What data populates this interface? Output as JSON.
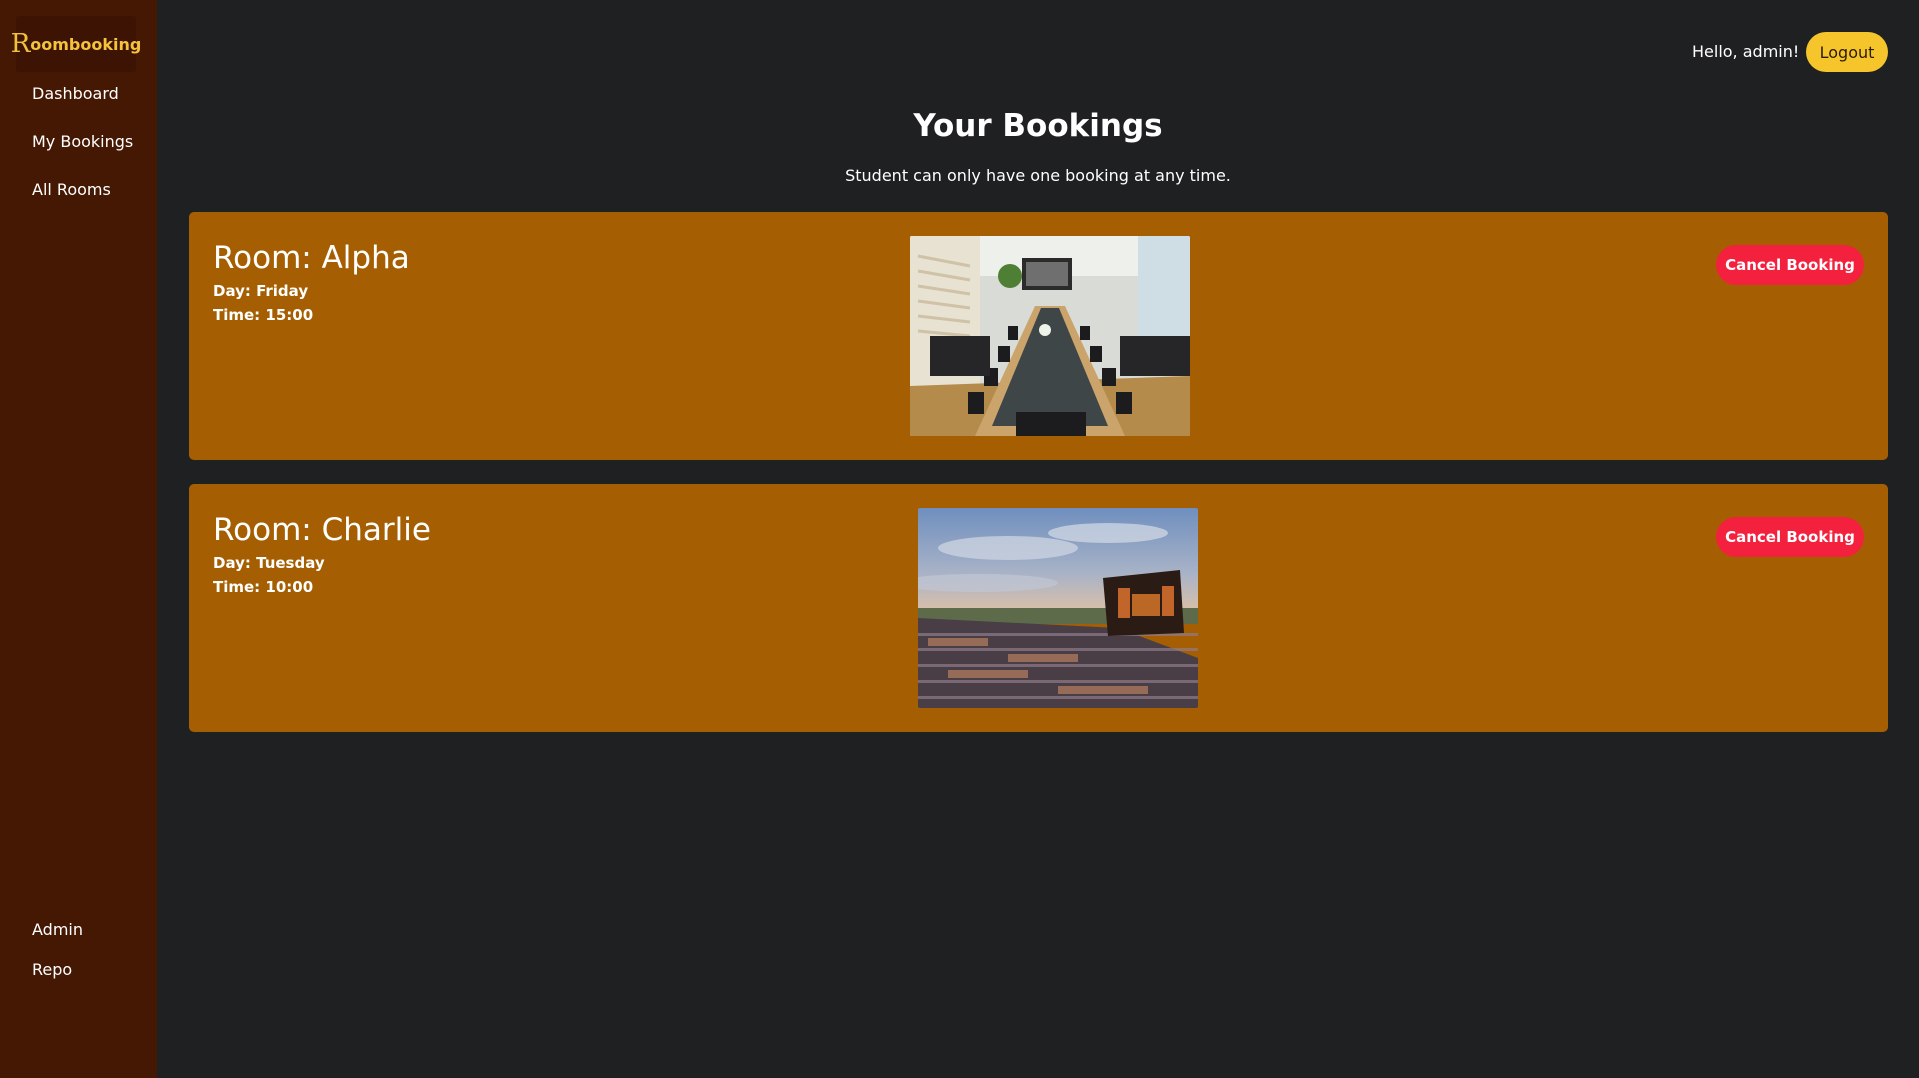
{
  "app": {
    "brand_initial": "R",
    "brand_rest": "oombooking"
  },
  "sidebar": {
    "items": [
      {
        "label": "Dashboard"
      },
      {
        "label": "My Bookings"
      },
      {
        "label": "All Rooms"
      }
    ],
    "bottom_items": [
      {
        "label": "Admin"
      },
      {
        "label": "Repo"
      }
    ]
  },
  "header": {
    "greeting": "Hello, admin!",
    "logout_label": "Logout"
  },
  "main": {
    "title": "Your Bookings",
    "subtitle": "Student can only have one booking at any time."
  },
  "bookings": [
    {
      "room": "Room: Alpha",
      "day": "Day: Friday",
      "time": "Time: 15:00",
      "image": "conference-room-photo",
      "cancel_label": "Cancel Booking"
    },
    {
      "room": "Room: Charlie",
      "day": "Day: Tuesday",
      "time": "Time: 10:00",
      "image": "amphitheater-photo",
      "cancel_label": "Cancel Booking"
    }
  ],
  "colors": {
    "sidebar_bg": "#451803",
    "page_bg": "#1f2022",
    "card_bg": "#a55f02",
    "logout_bg": "#f6c52c",
    "cancel_bg": "#f3203e",
    "brand_text": "#f5c33b"
  }
}
